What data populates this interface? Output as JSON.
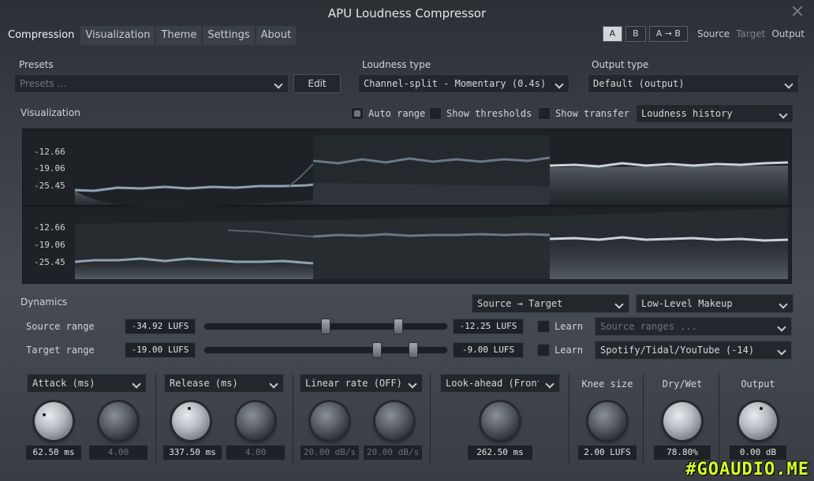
{
  "window": {
    "title": "APU Loudness Compressor"
  },
  "tabs": [
    "Compression",
    "Visualization",
    "Theme",
    "Settings",
    "About"
  ],
  "ab": {
    "a": "A",
    "b": "B",
    "atob": "A → B",
    "source": "Source",
    "target": "Target",
    "output": "Output"
  },
  "presets": {
    "label": "Presets",
    "placeholder": "Presets ...",
    "edit": "Edit"
  },
  "loudness_type": {
    "label": "Loudness type",
    "value": "Channel-split - Momentary (0.4s)"
  },
  "output_type": {
    "label": "Output type",
    "value": "Default (output)"
  },
  "visualization": {
    "label": "Visualization",
    "auto_range": "Auto range",
    "show_thresholds": "Show thresholds",
    "show_transfer": "Show transfer",
    "mode": "Loudness history",
    "axis_top": [
      "-12.66",
      "-19.06",
      "-25.45"
    ],
    "axis_bottom": [
      "-12.66",
      "-19.06",
      "-25.45"
    ]
  },
  "dynamics": {
    "label": "Dynamics",
    "mode": "Source → Target",
    "makeup": "Low-Level Makeup",
    "source_range": {
      "label": "Source range",
      "low": "-34.92 LUFS",
      "high": "-12.25 LUFS",
      "learn": "Learn",
      "preset": "Source ranges ...",
      "low_pos": 0.5,
      "high_pos": 0.8
    },
    "target_range": {
      "label": "Target range",
      "low": "-19.00 LUFS",
      "high": "-9.00 LUFS",
      "learn": "Learn",
      "preset": "Spotify/Tidal/YouTube (-14)",
      "low_pos": 0.71,
      "high_pos": 0.86
    }
  },
  "controls": {
    "attack": {
      "label": "Attack (ms)",
      "value": "62.50 ms",
      "ratio": "4.00"
    },
    "release": {
      "label": "Release (ms)",
      "value": "337.50 ms",
      "ratio": "4.00"
    },
    "linear_rate": {
      "label": "Linear rate (OFF)",
      "value1": "20.00 dB/s",
      "value2": "20.00 dB/s"
    },
    "lookahead": {
      "label": "Look-ahead (Front",
      "value": "262.50 ms"
    },
    "knee": {
      "label": "Knee size",
      "value": "2.00 LUFS"
    },
    "drywet": {
      "label": "Dry/Wet",
      "value": "78.80%"
    },
    "output": {
      "label": "Output",
      "value": "0.00 dB"
    }
  },
  "watermark": "#GOAUDIO.ME"
}
